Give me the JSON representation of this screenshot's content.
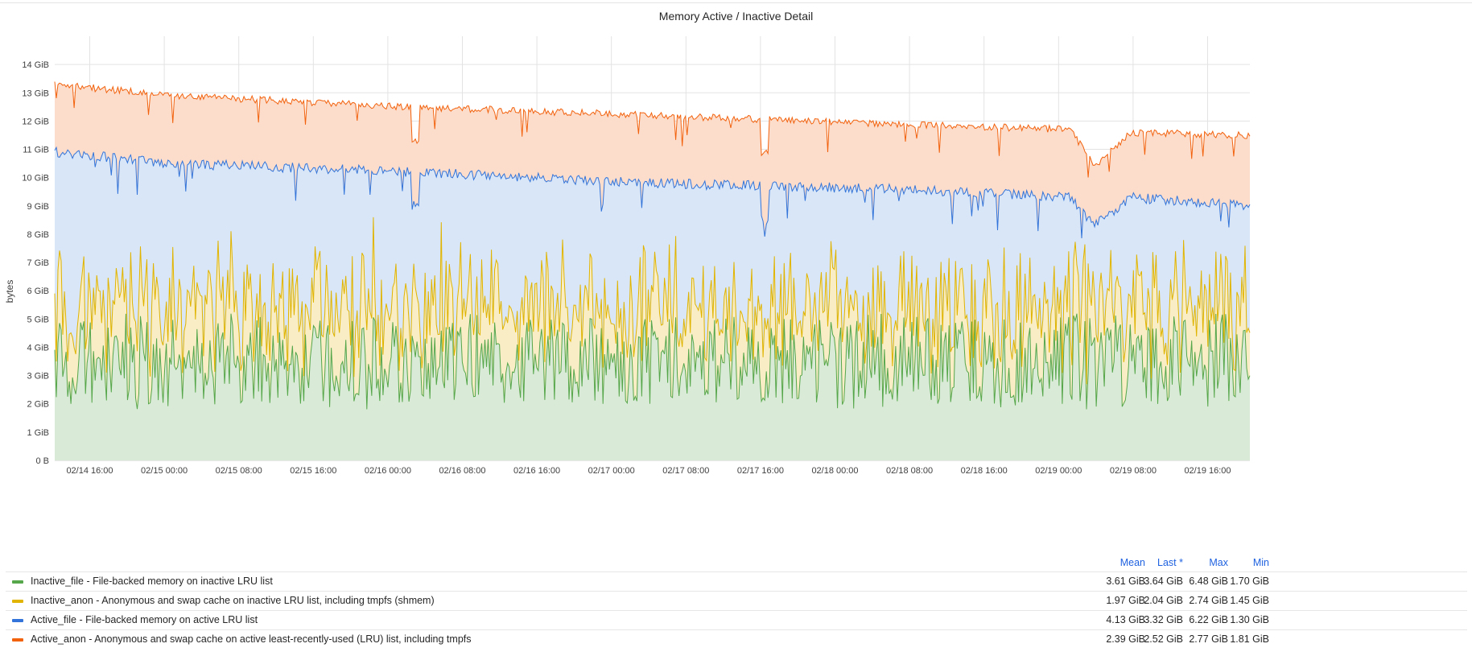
{
  "panel": {
    "title": "Memory Active / Inactive Detail"
  },
  "chart_data": {
    "type": "area",
    "stacked": true,
    "title": "Memory Active / Inactive Detail",
    "ylabel": "bytes",
    "yunit": "GiB",
    "ylim": [
      0,
      15
    ],
    "yticks": [
      "0 B",
      "1 GiB",
      "2 GiB",
      "3 GiB",
      "4 GiB",
      "5 GiB",
      "6 GiB",
      "7 GiB",
      "8 GiB",
      "9 GiB",
      "10 GiB",
      "11 GiB",
      "12 GiB",
      "13 GiB",
      "14 GiB"
    ],
    "xticks": [
      "02/14 16:00",
      "02/15 00:00",
      "02/15 08:00",
      "02/15 16:00",
      "02/16 00:00",
      "02/16 08:00",
      "02/16 16:00",
      "02/17 00:00",
      "02/17 08:00",
      "02/17 16:00",
      "02/18 00:00",
      "02/18 08:00",
      "02/18 16:00",
      "02/19 00:00",
      "02/19 08:00",
      "02/19 16:00"
    ],
    "xrange": [
      "02/14 11:00",
      "02/19 22:00"
    ],
    "grid": true,
    "legend_position": "bottom",
    "series": [
      {
        "name": "Inactive_file - File-backed memory on inactive LRU list",
        "color": "#56a64b",
        "fill": "#d9ebd6",
        "stats": {
          "mean": "3.61 GiB",
          "last": "3.64 GiB",
          "max": "6.48 GiB",
          "min": "1.70 GiB"
        },
        "typical_range": [
          2.0,
          5.3
        ]
      },
      {
        "name": "Inactive_anon - Anonymous and swap cache on inactive LRU list, including tmpfs (shmem)",
        "color": "#e0b400",
        "fill": "#f8edc5",
        "stats": {
          "mean": "1.97 GiB",
          "last": "2.04 GiB",
          "max": "2.74 GiB",
          "min": "1.45 GiB"
        },
        "typical_range": [
          4.0,
          7.0
        ]
      },
      {
        "name": "Active_file - File-backed memory on active LRU list",
        "color": "#3274d9",
        "fill": "#d8e6f8",
        "stats": {
          "mean": "4.13 GiB",
          "last": "3.32 GiB",
          "max": "6.22 GiB",
          "min": "1.30 GiB"
        },
        "stack_top_trend": [
          [
            0,
            10.9
          ],
          [
            0.1,
            10.5
          ],
          [
            0.3,
            10.2
          ],
          [
            0.5,
            9.8
          ],
          [
            0.7,
            9.6
          ],
          [
            0.85,
            9.3
          ],
          [
            0.87,
            8.3
          ],
          [
            0.9,
            9.3
          ],
          [
            1,
            9.0
          ]
        ]
      },
      {
        "name": "Active_anon - Anonymous and swap cache on active least-recently-used (LRU) list, including tmpfs",
        "color": "#f2620d",
        "fill": "#fcdccb",
        "stats": {
          "mean": "2.39 GiB",
          "last": "2.52 GiB",
          "max": "2.77 GiB",
          "min": "1.81 GiB"
        },
        "stack_top_trend": [
          [
            0,
            13.3
          ],
          [
            0.1,
            12.9
          ],
          [
            0.3,
            12.5
          ],
          [
            0.5,
            12.2
          ],
          [
            0.7,
            11.9
          ],
          [
            0.85,
            11.7
          ],
          [
            0.87,
            10.4
          ],
          [
            0.9,
            11.6
          ],
          [
            1,
            11.5
          ]
        ]
      }
    ]
  },
  "legend": {
    "headers": [
      "Mean",
      "Last *",
      "Max",
      "Min"
    ],
    "rows": [
      {
        "name": "Inactive_file - File-backed memory on inactive LRU list",
        "color": "#56a64b",
        "values": [
          "3.61 GiB",
          "3.64 GiB",
          "6.48 GiB",
          "1.70 GiB"
        ]
      },
      {
        "name": "Inactive_anon - Anonymous and swap cache on inactive LRU list, including tmpfs (shmem)",
        "color": "#e0b400",
        "values": [
          "1.97 GiB",
          "2.04 GiB",
          "2.74 GiB",
          "1.45 GiB"
        ]
      },
      {
        "name": "Active_file - File-backed memory on active LRU list",
        "color": "#3274d9",
        "values": [
          "4.13 GiB",
          "3.32 GiB",
          "6.22 GiB",
          "1.30 GiB"
        ]
      },
      {
        "name": "Active_anon - Anonymous and swap cache on active least-recently-used (LRU) list, including tmpfs",
        "color": "#f2620d",
        "values": [
          "2.39 GiB",
          "2.52 GiB",
          "2.77 GiB",
          "1.81 GiB"
        ]
      }
    ]
  }
}
